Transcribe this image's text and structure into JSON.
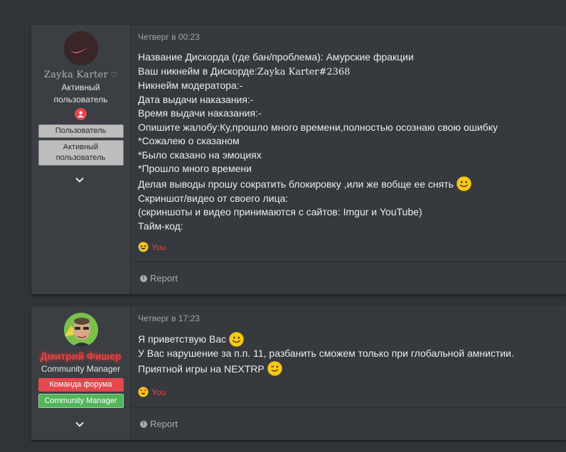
{
  "posts": [
    {
      "user": {
        "name": "Zayka Karter",
        "name_symbol": "♡",
        "title": "Активный пользователь",
        "banners": [
          "Пользователь",
          "Активный пользователь"
        ]
      },
      "date": "Четверг в 00:23",
      "lines": [
        "Название Дискорда (где бан/проблема): Амурские фракции",
        "Ваш никнейм в Дискорде:",
        "Никнейм модератора:-",
        "Дата выдачи наказания:-",
        "Время выдачи наказания:-",
        "Опишите жалобу:Ку,прошло много времени,полностью осознаю свою ошибку",
        "*Сожалею о сказаном",
        "*Было сказано на эмоциях",
        "*Прошло много времени",
        "Делая выводы прошу сократить блокировку ,или же вобще ее снять",
        "Скриншот/видео от своего лица:",
        "(скриншоты и видео принимаются с сайтов: Imgur и YouTube)",
        "Тайм-код:"
      ],
      "discord_nick": "Zayka Karter#2368",
      "reaction": {
        "label": "You",
        "icon": "laughing-emoji-icon"
      },
      "footer": {
        "report_label": "Report",
        "icon": "report-icon"
      }
    },
    {
      "user": {
        "name": "Дмитрий Фишер",
        "title": "Community Manager",
        "banners": [
          "Команда форума",
          "Community Manager"
        ]
      },
      "date": "Четверг в 17:23",
      "lines": [
        "Я приветствую Вас",
        "У Вас нарушение за п.п. 11, разбанить сможем только при глобальной амнистии.",
        "Приятной игры на NEXTRP"
      ],
      "reaction": {
        "label": "You",
        "icon": "heart-eyes-emoji-icon"
      },
      "footer": {
        "report_label": "Report",
        "icon": "report-icon"
      }
    }
  ],
  "colors": {
    "page_bg": "#303338",
    "post_bg": "#36393e",
    "user_bg": "#3b3e43",
    "accent_red": "#e5484d",
    "accent_green": "#53b45a"
  }
}
